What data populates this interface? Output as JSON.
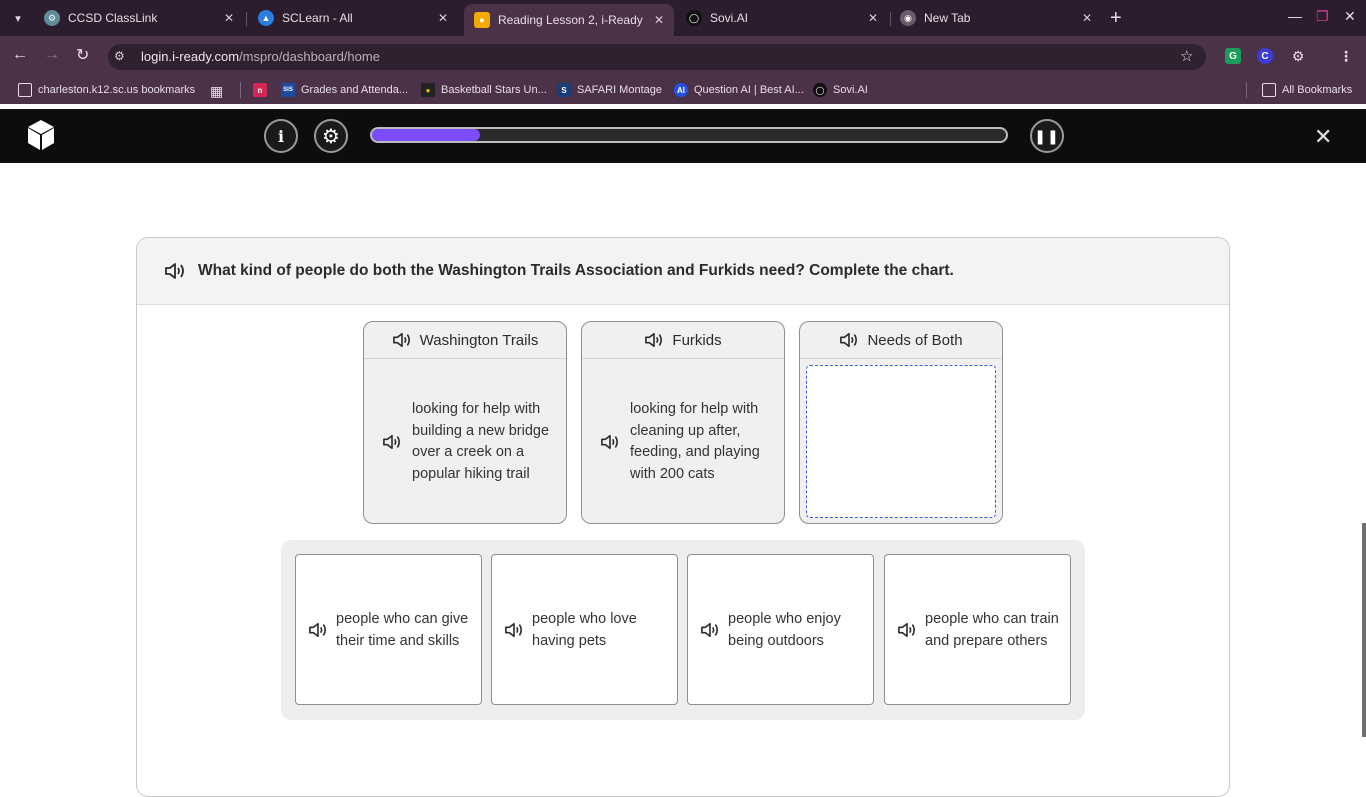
{
  "browser": {
    "tabs": [
      {
        "title": "CCSD ClassLink",
        "icon": "classlink-icon",
        "active": false
      },
      {
        "title": "SCLearn - All",
        "icon": "sclearn-icon",
        "active": false
      },
      {
        "title": "Reading Lesson 2, i-Ready",
        "icon": "iready-icon",
        "active": true
      },
      {
        "title": "Sovi.AI",
        "icon": "sovi-icon",
        "active": false
      },
      {
        "title": "New Tab",
        "icon": "chrome-icon",
        "active": false
      }
    ],
    "url_host": "login.i-ready.com",
    "url_path": "/mspro/dashboard/home",
    "bookmarks": [
      {
        "label": "charleston.k12.sc.us bookmarks"
      },
      {
        "label": "Grades and Attenda..."
      },
      {
        "label": "Basketball Stars Un..."
      },
      {
        "label": "SAFARI Montage"
      },
      {
        "label": "Question AI | Best AI..."
      },
      {
        "label": "Sovi.AI"
      }
    ],
    "all_bookmarks": "All Bookmarks",
    "ext_c_label": "C",
    "ext_g_label": "G",
    "bookmark_sis_label": "SIS",
    "bookmark_ai_label": "AI"
  },
  "lesson": {
    "progress_fraction": 0.17,
    "question": "What kind of people do both the Washington Trails Association and Furkids need? Complete the chart.",
    "columns": [
      {
        "header": "Washington Trails",
        "body": "looking for help with building a new bridge over a creek on a popular hiking trail"
      },
      {
        "header": "Furkids",
        "body": "looking for help with cleaning up after, feeding, and playing with 200 cats"
      },
      {
        "header": "Needs of Both",
        "body": ""
      }
    ],
    "choices": [
      "people who can give their time and skills",
      "people who love having pets",
      "people who enjoy being outdoors",
      "people who can train and prepare others"
    ]
  },
  "colors": {
    "progress": "#7c4dff",
    "appbar": "#0d0d0d",
    "browser_frame": "#2b1d2d",
    "drop_border": "#3a5fd9"
  }
}
